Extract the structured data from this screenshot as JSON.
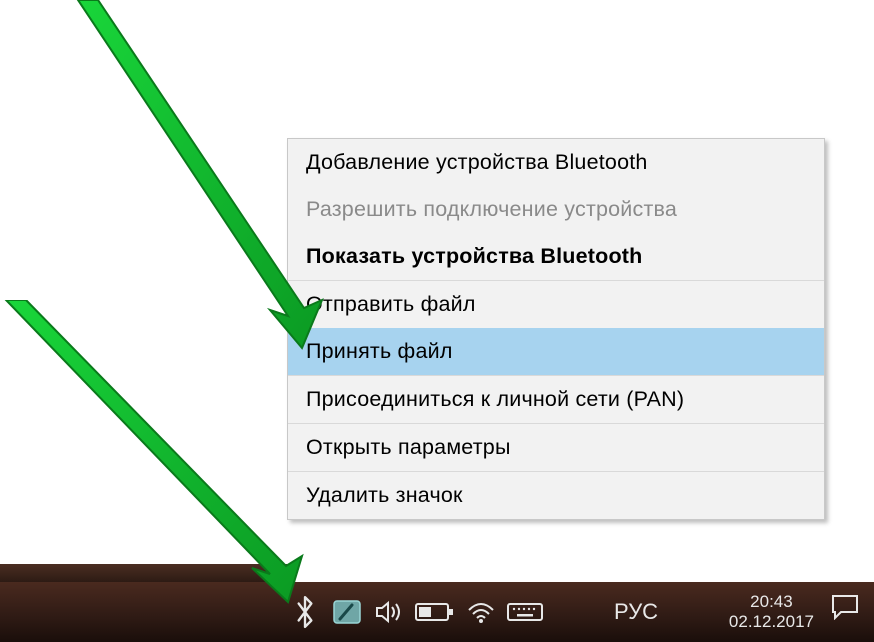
{
  "menu": {
    "add_device": "Добавление устройства Bluetooth",
    "allow_connect": "Разрешить подключение устройства",
    "show_devices": "Показать устройства Bluetooth",
    "send_file": "Отправить файл",
    "receive_file": "Принять файл",
    "join_pan": "Присоединиться к личной сети (PAN)",
    "open_settings": "Открыть параметры",
    "remove_icon": "Удалить значок"
  },
  "tray": {
    "language": "РУС",
    "time": "20:43",
    "date": "02.12.2017"
  }
}
